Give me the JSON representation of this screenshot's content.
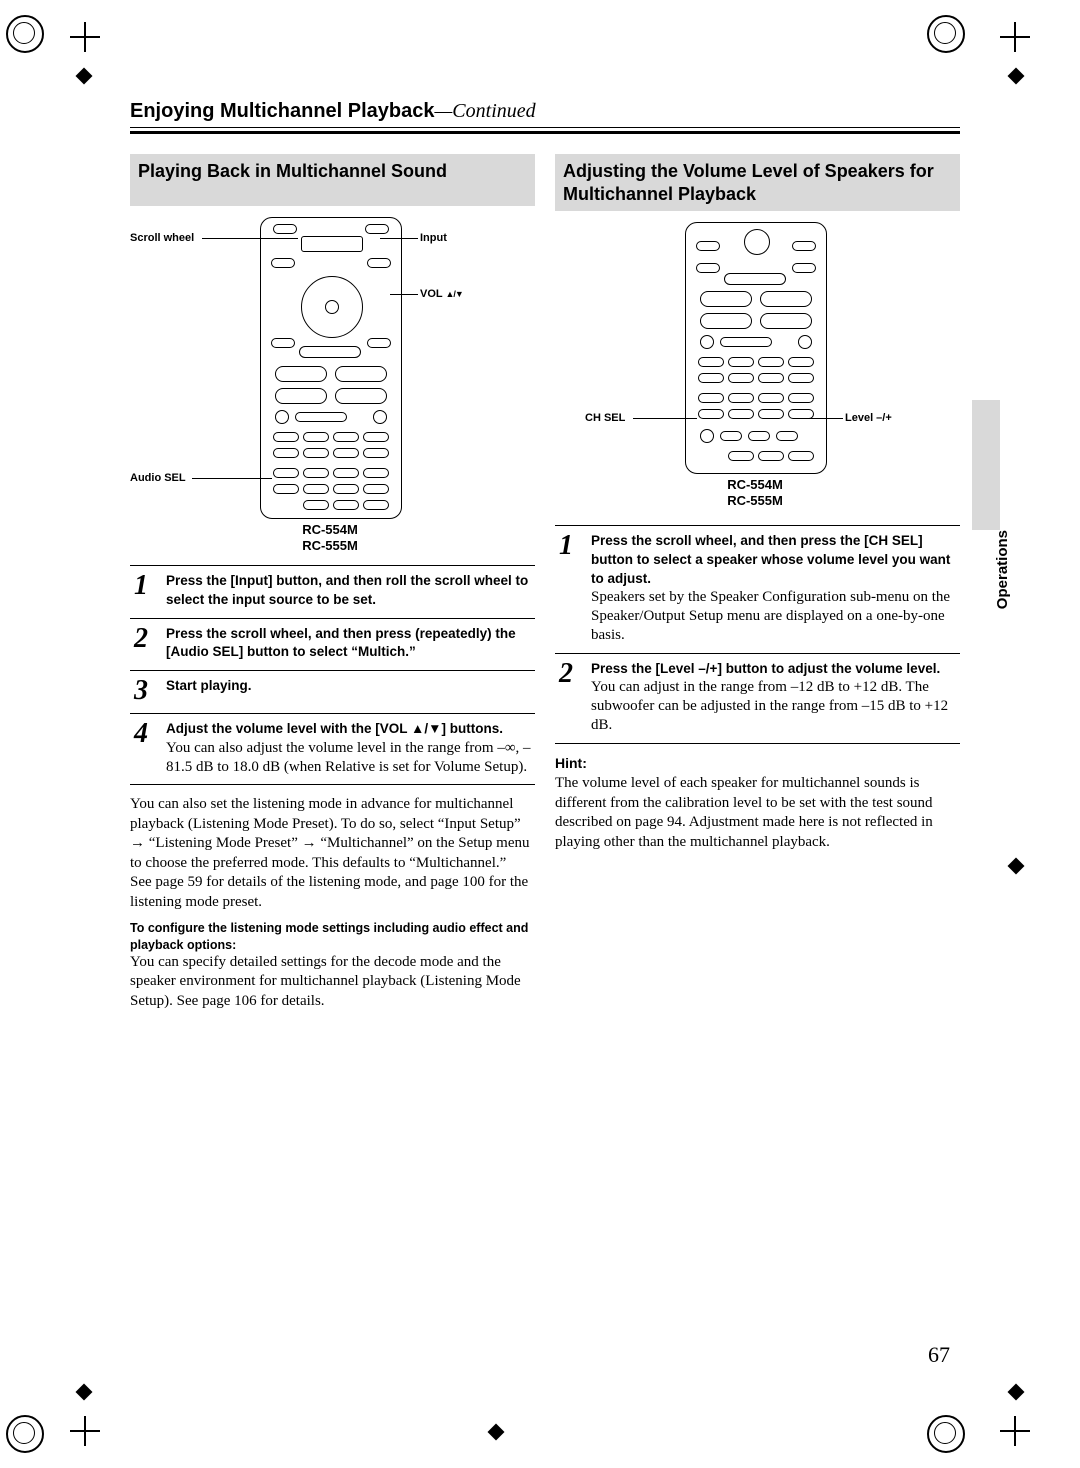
{
  "chapter": {
    "title": "Enjoying Multichannel Playback",
    "cont": "—Continued"
  },
  "side_tab": "Operations",
  "page_number": "67",
  "left": {
    "title": "Playing Back in Multichannel Sound",
    "fig": {
      "scroll_wheel": "Scroll wheel",
      "input": "Input",
      "vol": "VOL ",
      "audio_sel": "Audio SEL",
      "model1": "RC-554M",
      "model2": "RC-555M"
    },
    "steps": [
      {
        "n": "1",
        "bold": "Press the [Input] button, and then roll the scroll wheel to select the input source to be set."
      },
      {
        "n": "2",
        "bold": "Press the scroll wheel, and then press (repeatedly) the [Audio SEL] button to select “Multich.”"
      },
      {
        "n": "3",
        "bold": "Start playing."
      },
      {
        "n": "4",
        "bold": "Adjust the volume level with the [VOL ▲/▼] buttons.",
        "reg": "You can also adjust the volume level in the range from –∞, –81.5 dB to 18.0 dB (when Relative is set for Volume Setup)."
      }
    ],
    "para1": "You can also set the listening mode in advance for multichannel playback (Listening Mode Preset). To do so, select “Input Setup” → “Listening Mode Preset” → “Multichannel” on the Setup menu to choose the preferred mode. This defaults to “Multichannel.”",
    "para2": "See page 59 for details of the listening mode, and page 100 for the listening mode preset.",
    "subhead": "To configure the listening mode settings including audio effect and playback options:",
    "para3": "You can specify detailed settings for the decode mode and the speaker environment for multichannel playback (Listening Mode Setup). See page 106 for details."
  },
  "right": {
    "title": "Adjusting the Volume Level of Speakers for Multichannel Playback",
    "fig": {
      "ch_sel": "CH SEL",
      "level": "Level –/+",
      "model1": "RC-554M",
      "model2": "RC-555M"
    },
    "steps": [
      {
        "n": "1",
        "bold": "Press the scroll wheel, and then press the [CH SEL] button to select a speaker whose volume level you want to adjust.",
        "reg": "Speakers set by the Speaker Configuration sub-menu on the Speaker/Output Setup menu are displayed on a one-by-one basis."
      },
      {
        "n": "2",
        "bold": "Press the [Level –/+] button to adjust the volume level.",
        "reg": "You can adjust in the range from –12 dB to +12 dB. The subwoofer can be adjusted in the range from –15 dB to +12 dB."
      }
    ],
    "hint_label": "Hint:",
    "hint_body": "The volume level of each speaker for multichannel sounds is different from the calibration level to be set with the test sound described on page 94. Adjustment made here is not reflected in playing other than the multichannel playback."
  }
}
